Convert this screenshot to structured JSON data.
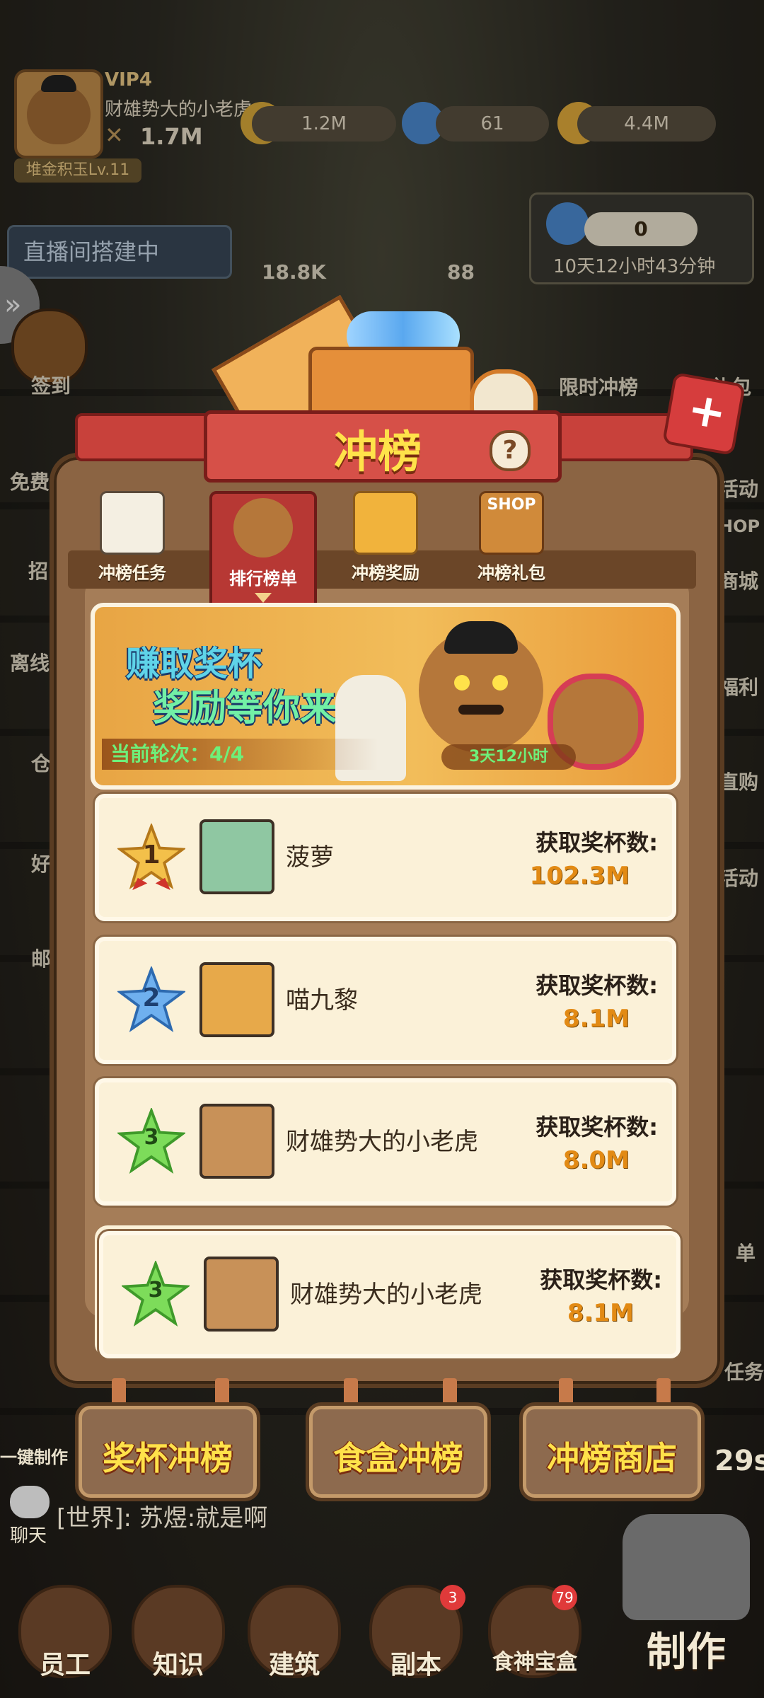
{
  "hud": {
    "vip": "VIP4",
    "player_name": "财雄势大的小老虎",
    "power": "1.7M",
    "title_badge": "堆金积玉Lv.11",
    "trophies": "1.2M",
    "gems": "61",
    "coins": "4.4M",
    "ticket_text": "直播间搭建中",
    "bubble_1": "18.8K",
    "bubble_2": "88",
    "gem_box_value": "0",
    "gem_box_timer": "10天12小时43分钟"
  },
  "side_left": [
    "签到",
    "免费",
    "招",
    "离线",
    "仓",
    "好",
    "邮"
  ],
  "side_right": [
    "限时冲榜",
    "礼包",
    "活动",
    "HOP",
    "商城",
    "福利",
    "直购",
    "活动",
    "单",
    "任务"
  ],
  "modal": {
    "title": "冲榜",
    "help": "?",
    "tabs": [
      {
        "label": "冲榜任务",
        "icon": "task-icon"
      },
      {
        "label": "排行榜单",
        "icon": "bear-icon",
        "active": true
      },
      {
        "label": "冲榜奖励",
        "icon": "reward-icon"
      },
      {
        "label": "冲榜礼包",
        "icon": "shop-icon"
      }
    ],
    "shop_sign": "SHOP",
    "banner": {
      "line1": "赚取奖杯",
      "line2": "奖励等你来领",
      "round": "当前轮次：4/4",
      "timer": "3天12小时"
    },
    "ranks": [
      {
        "rank": "1",
        "name": "菠萝",
        "label": "获取奖杯数:",
        "value": "102.3M",
        "star_color": "#f3c04a"
      },
      {
        "rank": "2",
        "name": "喵九黎",
        "label": "获取奖杯数:",
        "value": "8.1M",
        "star_color": "#6fb0ef"
      },
      {
        "rank": "3",
        "name": "财雄势大的小老虎",
        "label": "获取奖杯数:",
        "value": "8.0M",
        "star_color": "#7ddc5a"
      }
    ],
    "my_rank": {
      "rank": "3",
      "name": "财雄势大的小老虎",
      "label": "获取奖杯数:",
      "value": "8.1M",
      "star_color": "#7ddc5a"
    }
  },
  "bottom_buttons": [
    "奖杯冲榜",
    "食盒冲榜",
    "冲榜商店"
  ],
  "chat": {
    "label": "聊天",
    "message": "[世界]: 苏煜:就是啊"
  },
  "partial_labels": {
    "one_key": "一键制作",
    "count_right": "29s"
  },
  "nav": [
    {
      "label": "员工",
      "badge": ""
    },
    {
      "label": "知识",
      "badge": ""
    },
    {
      "label": "建筑",
      "badge": ""
    },
    {
      "label": "副本",
      "badge": "3"
    },
    {
      "label": "食神宝盒",
      "badge": "79"
    }
  ],
  "make_button": "制作"
}
